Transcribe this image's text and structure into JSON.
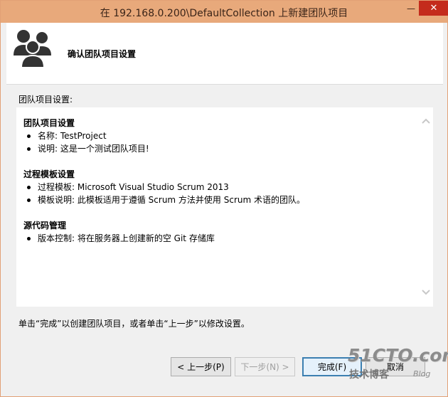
{
  "window": {
    "title": "在 192.168.0.200\\DefaultCollection 上新建团队项目",
    "minimize": "—",
    "close": "✕"
  },
  "header": {
    "title": "确认团队项目设置",
    "icon": "team-group-icon"
  },
  "section_label": "团队项目设置:",
  "summary": {
    "groups": [
      {
        "title": "团队项目设置",
        "items": [
          "名称: TestProject",
          "说明: 这是一个测试团队项目!"
        ]
      },
      {
        "title": "过程模板设置",
        "items": [
          "过程模板: Microsoft Visual Studio Scrum 2013",
          "模板说明: 此模板适用于遵循 Scrum 方法并使用 Scrum 术语的团队。"
        ]
      },
      {
        "title": "源代码管理",
        "items": [
          "版本控制: 将在服务器上创建新的空 Git 存储库"
        ]
      }
    ]
  },
  "hint": "单击“完成”以创建团队项目，或者单击“上一步”以修改设置。",
  "buttons": {
    "back": "< 上一步(P)",
    "next": "下一步(N) >",
    "finish": "完成(F)",
    "cancel": "取消"
  },
  "watermark": {
    "top": "51CTO.com",
    "bottom": "技术博客",
    "blog": "Blog"
  }
}
